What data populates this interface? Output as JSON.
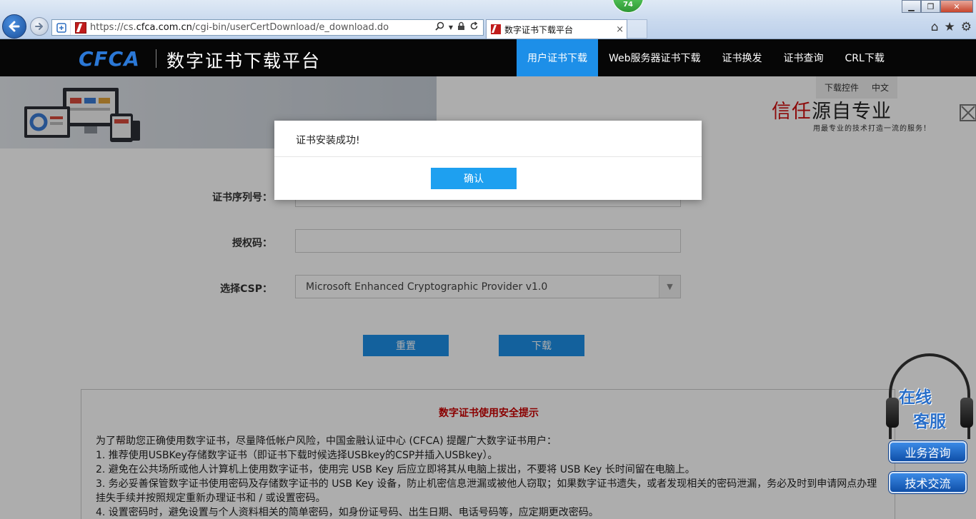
{
  "browser": {
    "url_prefix": "https://cs.",
    "url_domain": "cfca.com.cn",
    "url_path": "/cgi-bin/userCertDownload/e_download.do",
    "tab_title": "数字证书下载平台",
    "tab_close": "×",
    "badge_count": "74",
    "window_buttons": {
      "minimize": "▁",
      "maximize": "❐",
      "close": "✕"
    },
    "icons": {
      "home": "⌂",
      "favorites": "★",
      "tools": "⚙"
    }
  },
  "site": {
    "logo": "CFCA",
    "title": "数字证书下载平台",
    "nav": [
      {
        "label": "用户证书下载",
        "active": true
      },
      {
        "label": "Web服务器证书下载"
      },
      {
        "label": "证书换发"
      },
      {
        "label": "证书查询"
      },
      {
        "label": "CRL下载"
      }
    ]
  },
  "banner": {
    "tool_download": "下载控件",
    "tool_lang": "中文",
    "slogan_red": "信任",
    "slogan_black": "源自专业",
    "sub": "用最专业的技术打造一流的服务！"
  },
  "form": {
    "serial_label": "证书序列号：",
    "auth_label": "授权码：",
    "csp_label": "选择CSP：",
    "csp_value": "Microsoft Enhanced Cryptographic Provider v1.0",
    "reset_label": "重置",
    "download_label": "下载"
  },
  "notice": {
    "title": "数字证书使用安全提示",
    "lines": [
      "为了帮助您正确使用数字证书，尽量降低帐户风险，中国金融认证中心 (CFCA) 提醒广大数字证书用户：",
      "1. 推荐使用USBKey存储数字证书（即证书下载时候选择USBkey的CSP并插入USBkey）。",
      "2. 避免在公共场所或他人计算机上使用数字证书，使用完 USB Key 后应立即将其从电脑上拔出，不要将 USB Key 长时间留在电脑上。",
      "3. 务必妥善保管数字证书使用密码及存储数字证书的 USB Key 设备，防止机密信息泄漏或被他人窃取；如果数字证书遗失，或者发现相关的密码泄漏，务必及时到申请网点办理挂失手续并按照规定重新办理证书和 / 或设置密码。",
      "4. 设置密码时，避免设置与个人资料相关的简单密码，如身份证号码、出生日期、电话号码等，应定期更改密码。"
    ]
  },
  "dialog": {
    "message": "证书安装成功!",
    "ok_label": "确认"
  },
  "service": {
    "line1": "在线",
    "line2": "客服",
    "consult": "业务咨询",
    "tech": "技术交流"
  },
  "colors": {
    "primary": "#1d8fe8",
    "header_bg": "#060606",
    "notice_title": "#cc0000",
    "logo": "#2b78d6"
  }
}
